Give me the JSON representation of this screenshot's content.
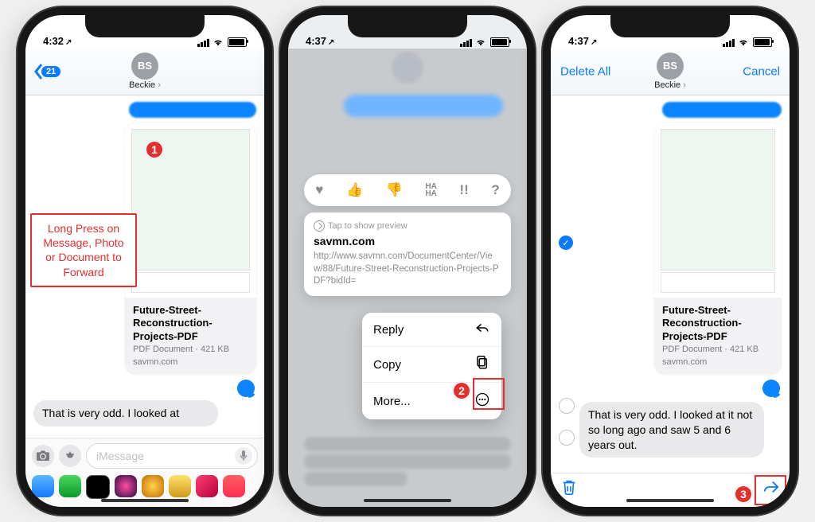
{
  "phone1": {
    "time": "4:32",
    "back_count": "21",
    "avatar_initials": "BS",
    "contact_name": "Beckie",
    "doc": {
      "title": "Future-Street-Reconstruction-Projects-PDF",
      "subtitle": "PDF Document · 421 KB",
      "source": "savmn.com"
    },
    "incoming_msg": "That is very odd. I looked at",
    "placeholder": "iMessage",
    "callout": "Long Press on Message, Photo or Document to Forward",
    "step": "1"
  },
  "phone2": {
    "time": "4:37",
    "tapbacks": [
      "♥",
      "👍",
      "👎",
      "HA HA",
      "!!",
      "?"
    ],
    "preview_hint": "Tap to show preview",
    "host": "savmn.com",
    "url": "http://www.savmn.com/DocumentCenter/View/88/Future-Street-Reconstruction-Projects-PDF?bidId=",
    "menu": {
      "reply": "Reply",
      "copy": "Copy",
      "more": "More..."
    },
    "step": "2"
  },
  "phone3": {
    "time": "4:37",
    "delete_all": "Delete All",
    "cancel": "Cancel",
    "avatar_initials": "BS",
    "contact_name": "Beckie",
    "doc": {
      "title": "Future-Street-Reconstruction-Projects-PDF",
      "subtitle": "PDF Document · 421 KB",
      "source": "savmn.com"
    },
    "incoming_msg": "That is very odd. I looked at it not so long ago and saw 5 and 6 years out.",
    "step": "3"
  },
  "app_tray_colors": [
    "#2590ff",
    "#000000",
    "#000000",
    "#16161a",
    "#e54d1e",
    "#d3b04a",
    "#ff2e63",
    "#ff2d55"
  ]
}
